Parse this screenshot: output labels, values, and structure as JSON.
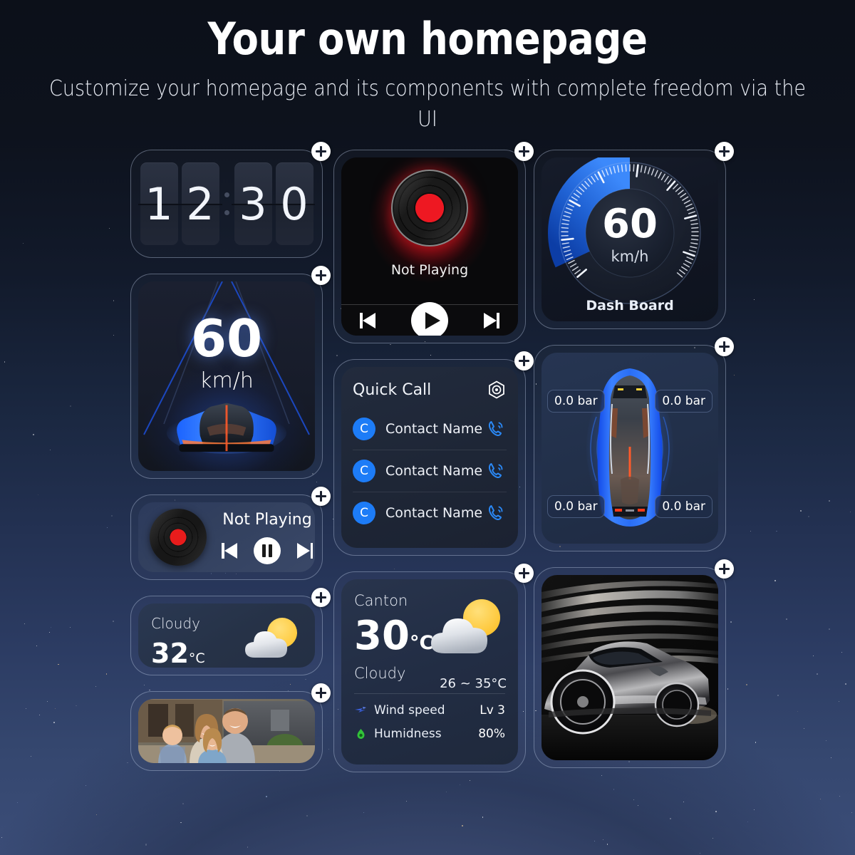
{
  "header": {
    "title": "Your own homepage",
    "subtitle": "Customize your homepage and its components with complete freedom via the UI"
  },
  "add_button_label": "+",
  "colors": {
    "accent_blue": "#1d7cf7",
    "gauge_blue": "#2f7ef0",
    "record_red": "#ee1822",
    "sun_yellow": "#ffd24d",
    "humidity_green": "#3ec63e",
    "widget_border": "#b7c6e0",
    "background_top": "#0c1019",
    "background_bottom": "#3b4d78"
  },
  "widgets": {
    "clock": {
      "name": "Flip Clock",
      "digits": [
        "1",
        "2",
        "3",
        "0"
      ],
      "separator": ":"
    },
    "speed_hud": {
      "name": "Speed HUD",
      "value": "60",
      "unit": "km/h"
    },
    "mini_player": {
      "name": "Mini Music Player",
      "status": "Not Playing",
      "controls": [
        "previous-track",
        "pause",
        "next-track"
      ]
    },
    "weather_small": {
      "name": "Weather Compact",
      "condition": "Cloudy",
      "temperature": "32",
      "unit": "°C",
      "icon": "sun-behind-cloud"
    },
    "family_photo": {
      "name": "Photo Frame",
      "caption": ""
    },
    "player": {
      "name": "Music Player",
      "status": "Not Playing",
      "controls": [
        "previous-track",
        "play",
        "next-track"
      ]
    },
    "quick_call": {
      "name": "Quick Call",
      "title": "Quick Call",
      "settings_icon": "hexagon-settings-icon",
      "contacts": [
        {
          "initial": "C",
          "name": "Contact Name",
          "action_icon": "phone-call-icon"
        },
        {
          "initial": "C",
          "name": "Contact Name",
          "action_icon": "phone-call-icon"
        },
        {
          "initial": "C",
          "name": "Contact Name",
          "action_icon": "phone-call-icon"
        }
      ]
    },
    "weather_big": {
      "name": "Weather Detailed",
      "city": "Canton",
      "temperature": "30",
      "unit": "°C",
      "range": "26 ~ 35°C",
      "condition": "Cloudy",
      "icon": "sun-behind-cloud",
      "metrics": [
        {
          "icon": "wind-icon",
          "label": "Wind speed",
          "value": "Lv 3"
        },
        {
          "icon": "humidity-icon",
          "label": "Humidness",
          "value": "80%"
        }
      ]
    },
    "dashboard": {
      "name": "Dash Board",
      "value": "60",
      "unit": "km/h",
      "label": "Dash Board"
    },
    "tpms": {
      "name": "Tire Pressure",
      "tires": [
        {
          "position": "front-left",
          "value": "0.0",
          "unit": "bar"
        },
        {
          "position": "front-right",
          "value": "0.0",
          "unit": "bar"
        },
        {
          "position": "rear-left",
          "value": "0.0",
          "unit": "bar"
        },
        {
          "position": "rear-right",
          "value": "0.0",
          "unit": "bar"
        }
      ]
    },
    "car_photo": {
      "name": "Car Photo",
      "caption": ""
    }
  }
}
